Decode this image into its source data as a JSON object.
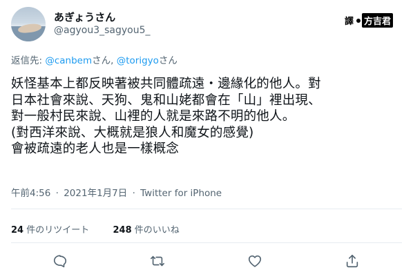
{
  "author": {
    "display_name": "あぎょうさん",
    "handle": "@agyou3_sagyou5_"
  },
  "watermark": {
    "left": "譯",
    "right": "方吉君"
  },
  "reply": {
    "prefix": "返信先: ",
    "user1": "@canbem",
    "suffix1": "さん, ",
    "user2": "@torigyo",
    "suffix2": "さん"
  },
  "tweet": {
    "lines": [
      "妖怪基本上都反映著被共同體疏遠・邊緣化的他人。對",
      "日本社會來說、天狗、鬼和山姥都會在「山」裡出現、",
      "對一般村民來說、山裡的人就是來路不明的他人。",
      "(對西洋來說、大概就是狼人和魔女的感覺)",
      "會被疏遠的老人也是一樣概念"
    ]
  },
  "meta": {
    "time": "午前4:56",
    "separator1": "·",
    "date": "2021年1月7日",
    "separator2": "·",
    "client": "Twitter for iPhone"
  },
  "stats": {
    "retweets_count": "24",
    "retweets_label": " 件のリツイート",
    "likes_count": "248",
    "likes_label": " 件のいいね"
  },
  "icons": {
    "reply": "reply-icon",
    "retweet": "retweet-icon",
    "like": "heart-icon",
    "share": "share-icon"
  }
}
